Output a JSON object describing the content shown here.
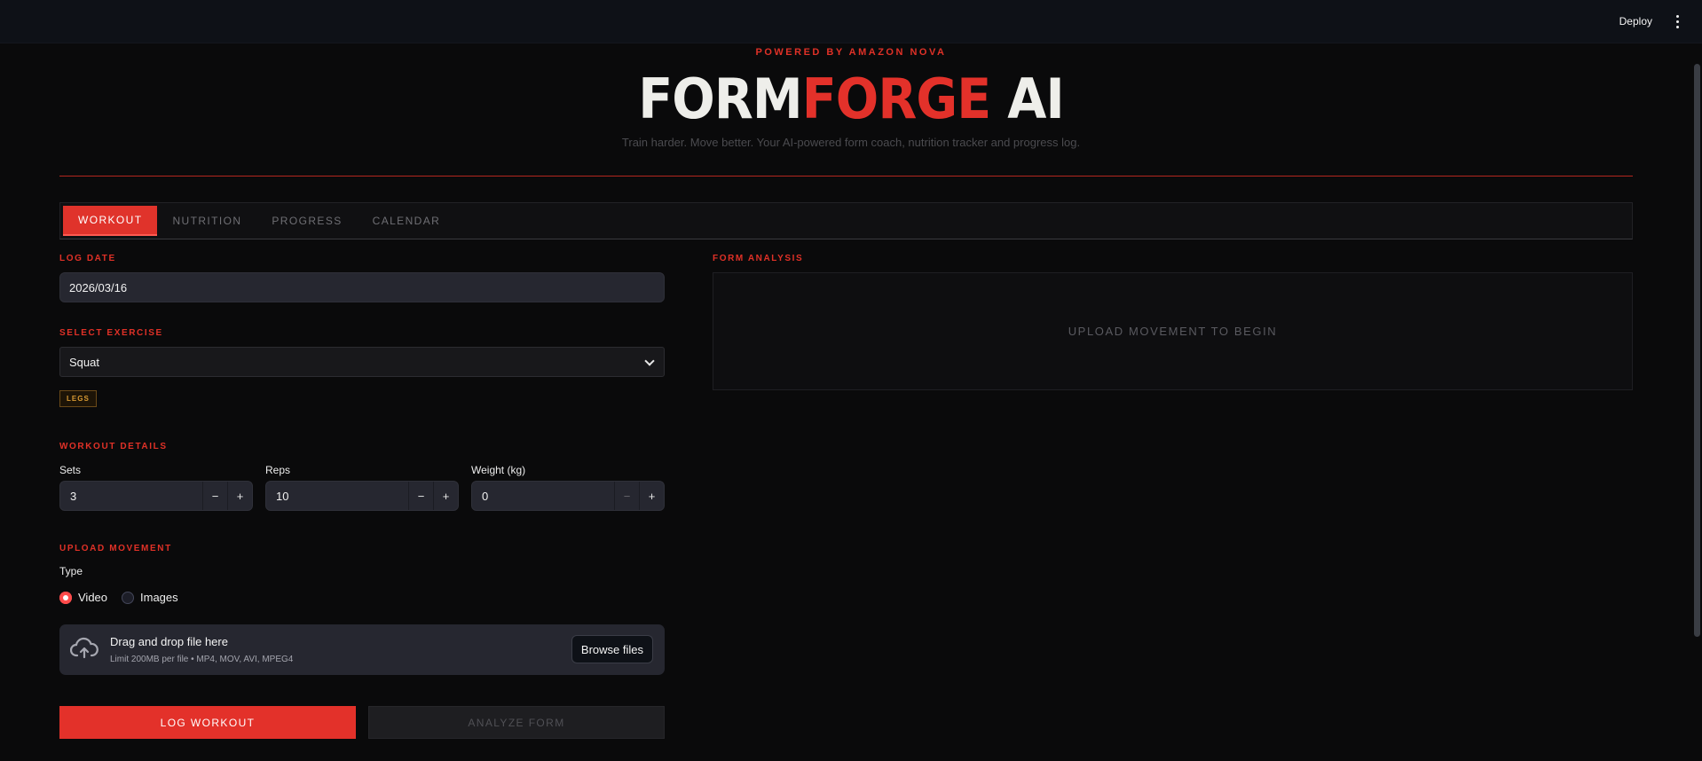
{
  "topbar": {
    "deploy_label": "Deploy",
    "menu_icon": "kebab-menu-icon"
  },
  "header": {
    "powered_by": "POWERED BY AMAZON NOVA",
    "title_part1": "FORM",
    "title_part2": "FORGE",
    "title_part3": " AI",
    "subtitle": "Train harder. Move better. Your AI-powered form coach, nutrition tracker and progress log."
  },
  "tabs": [
    {
      "label": "WORKOUT",
      "active": true
    },
    {
      "label": "NUTRITION",
      "active": false
    },
    {
      "label": "PROGRESS",
      "active": false
    },
    {
      "label": "CALENDAR",
      "active": false
    }
  ],
  "log_date": {
    "label": "LOG DATE",
    "value": "2026/03/16"
  },
  "exercise": {
    "label": "SELECT EXERCISE",
    "selected": "Squat",
    "tag": "LEGS"
  },
  "workout_details": {
    "label": "WORKOUT DETAILS",
    "sets": {
      "label": "Sets",
      "value": "3",
      "minus": "−",
      "plus": "+"
    },
    "reps": {
      "label": "Reps",
      "value": "10",
      "minus": "−",
      "plus": "+"
    },
    "weight": {
      "label": "Weight (kg)",
      "value": "0",
      "minus": "−",
      "plus": "+"
    }
  },
  "upload": {
    "label": "UPLOAD MOVEMENT",
    "type_label": "Type",
    "options": [
      "Video",
      "Images"
    ],
    "selected": "Video",
    "drop_title": "Drag and drop file here",
    "drop_limit": "Limit 200MB per file • MP4, MOV, AVI, MPEG4",
    "browse_label": "Browse files",
    "upload_icon": "cloud-upload-icon"
  },
  "actions": {
    "log_label": "LOG WORKOUT",
    "analyze_label": "ANALYZE FORM"
  },
  "form_analysis": {
    "label": "FORM ANALYSIS",
    "placeholder": "UPLOAD MOVEMENT TO BEGIN"
  },
  "colors": {
    "accent": "#e3312a",
    "background": "#0a0a0b",
    "tag": "#d89a33"
  }
}
